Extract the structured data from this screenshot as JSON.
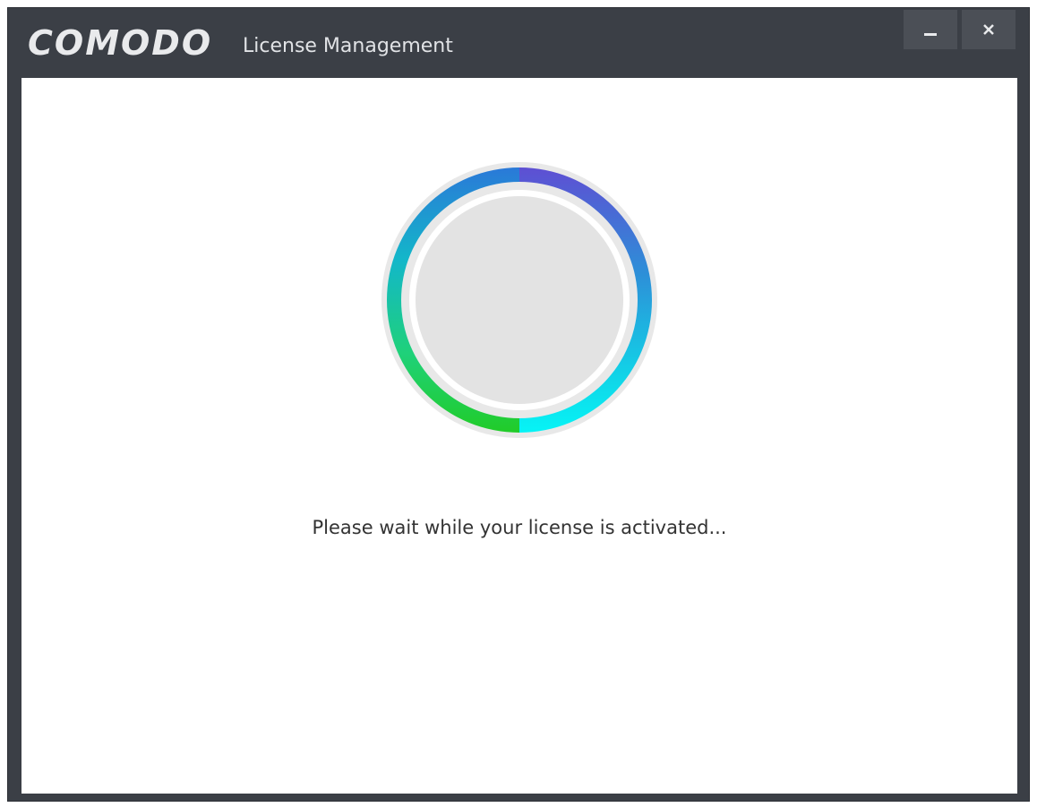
{
  "window": {
    "brand": "COMODO",
    "title": "License Management",
    "minimize_label": "minimize",
    "close_label": "close"
  },
  "main": {
    "message": "Please wait while your license is activated..."
  },
  "colors": {
    "titlebar": "#3b3f46",
    "ring_blue": "#5a55d6",
    "ring_cyan": "#17c8d8",
    "ring_green": "#22cc33",
    "ring_track": "#e6e6e6",
    "center_disc": "#e3e3e3"
  },
  "icons": [
    "minimize-icon",
    "close-icon",
    "progress-spinner"
  ]
}
